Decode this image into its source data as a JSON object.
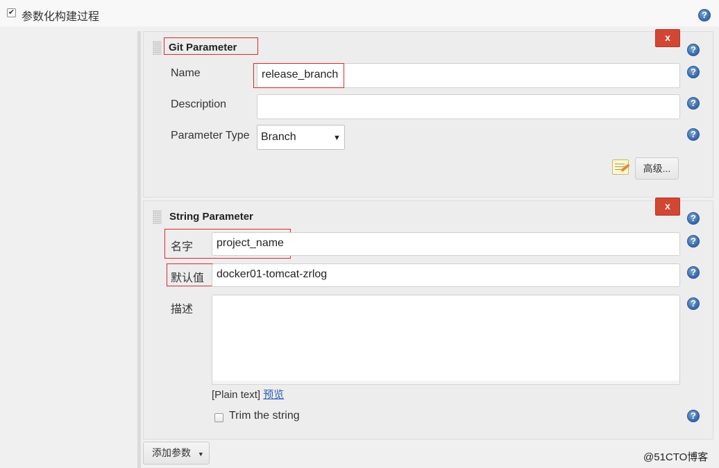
{
  "section": {
    "checkbox_checked": true,
    "label": "参数化构建过程"
  },
  "git_parameter": {
    "title": "Git Parameter",
    "delete_label": "x",
    "name_label": "Name",
    "name_value": "release_branch",
    "description_label": "Description",
    "description_value": "",
    "type_label": "Parameter Type",
    "type_value": "Branch",
    "advanced_label": "高级..."
  },
  "string_parameter": {
    "title": "String Parameter",
    "delete_label": "x",
    "name_label": "名字",
    "name_value": "project_name",
    "default_label": "默认值",
    "default_value": "docker01-tomcat-zrlog",
    "description_label": "描述",
    "description_value": "",
    "format_prefix": "[Plain text]",
    "preview_link": "预览",
    "trim_label": "Trim the string",
    "trim_checked": false
  },
  "add_parameter_label": "添加参数",
  "help_glyph": "?",
  "watermark": "@51CTO博客",
  "colors": {
    "delete_button": "#d24634",
    "highlight_border": "#e0262d",
    "help_icon": "#3b6fb2",
    "link": "#2b5fb3"
  }
}
